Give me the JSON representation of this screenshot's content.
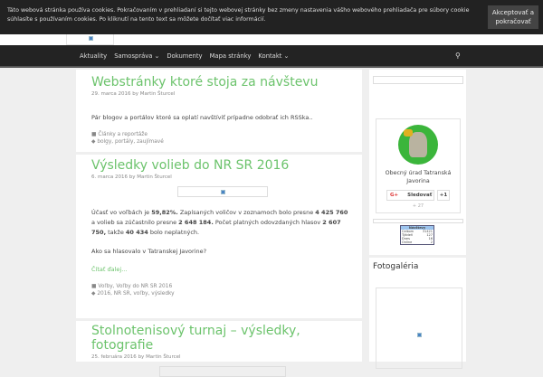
{
  "cookie": {
    "text": "Táto webová stránka používa cookies. Pokračovaním v prehliadaní si tejto webovej stránky bez zmeny nastavenia vášho webového prehliadača pre súbory cookie súhlasíte s používaním cookies. Po kliknutí na tento text sa môžete dočítať viac informácií.",
    "accept": "Akceptovať a pokračovať"
  },
  "nav": {
    "items": [
      "Aktuality",
      "Samospráva ⌄",
      "Dokumenty",
      "Mapa stránky",
      "Kontakt ⌄"
    ],
    "search_icon": "search-icon"
  },
  "posts": [
    {
      "title": "Webstránky ktoré stoja za návštevu",
      "date": "29. marca 2016",
      "by": "by",
      "author": "Martin Šturcel",
      "excerpt": "Pár blogov a portálov ktoré sa oplatí navštíviť prípadne odobrať ich RSSka..",
      "categories": "Články a reportáže",
      "tags": "bolgy, portály, zaujímavé"
    },
    {
      "title": "Výsledky volieb do NR SR 2016",
      "date": "6. marca 2016",
      "by": "by",
      "author": "Martin Šturcel",
      "p1": {
        "a": "Účasť vo voľbách je ",
        "b": "59,82%.",
        "c": " Zapísaných voličov v zoznamoch bolo presne ",
        "d": "4 425 760",
        "e": " a volieb sa zúčastnilo presne ",
        "f": "2 648 184.",
        "g": " Počet platných odovzdaných hlasov ",
        "h": "2 607 750,",
        "i": " takže ",
        "j": "40 434",
        "k": " bolo neplatných."
      },
      "p2": "Ako sa hlasovalo v Tatranskej Javorine?",
      "more": "Čítať ďalej...",
      "categories": "Voľby, Voľby do NR SR 2016",
      "tags": "2016, NR SR, voľby, výsledky"
    },
    {
      "title": "Stolnotenisový turnaj – výsledky, fotografie",
      "date": "25. februára 2016",
      "by": "by",
      "author": "Martin Šturcel"
    }
  ],
  "sidebar": {
    "gplus": {
      "name": "Obecný úrad Tatranská Javorina",
      "follow": "Sledovať",
      "plus": "+1",
      "count": "+ 27"
    },
    "stats": {
      "title": "Návštevy",
      "rows": [
        [
          "Celkom",
          "31421"
        ],
        [
          "Týždeň",
          "127"
        ],
        [
          "Dnes",
          "16"
        ],
        [
          "Online",
          "2"
        ]
      ]
    },
    "gallery_title": "Fotogaléria"
  }
}
